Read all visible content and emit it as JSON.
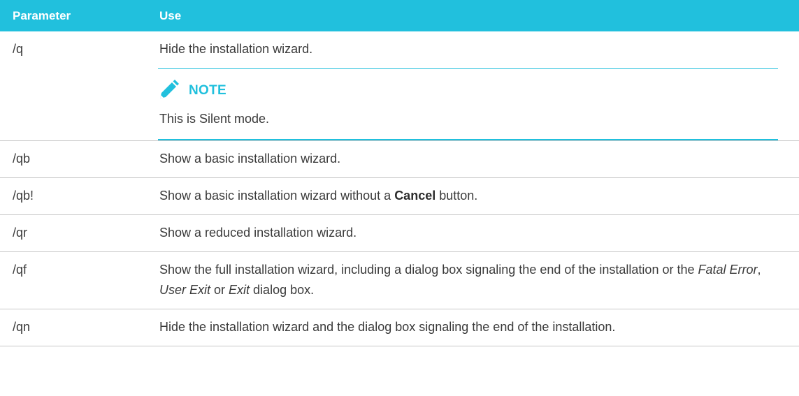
{
  "table": {
    "headers": {
      "parameter": "Parameter",
      "use": "Use"
    },
    "rows": [
      {
        "param": "/q",
        "use": "Hide the installation wizard.",
        "note": {
          "title": "NOTE",
          "text": "This is Silent mode."
        }
      },
      {
        "param": "/qb",
        "use": "Show a basic installation wizard."
      },
      {
        "param": "/qb!",
        "use_before": "Show a basic installation wizard without a ",
        "use_bold": "Cancel",
        "use_after": " button."
      },
      {
        "param": "/qr",
        "use": "Show a reduced installation wizard."
      },
      {
        "param": "/qf",
        "use_part1": "Show the full installation wizard, including a dialog box signaling the end of the installation or the ",
        "use_italic1": "Fatal Error",
        "use_part2": ", ",
        "use_italic2": "User Exit",
        "use_part3": " or ",
        "use_italic3": "Exit",
        "use_part4": " dialog box."
      },
      {
        "param": "/qn",
        "use": "Hide the installation wizard and the dialog box signaling the end of the installation."
      }
    ]
  },
  "colors": {
    "accent": "#21c0dd",
    "text": "#3a3a3a",
    "rule": "#c8c8c8"
  },
  "icons": {
    "note": "pencil-icon"
  }
}
